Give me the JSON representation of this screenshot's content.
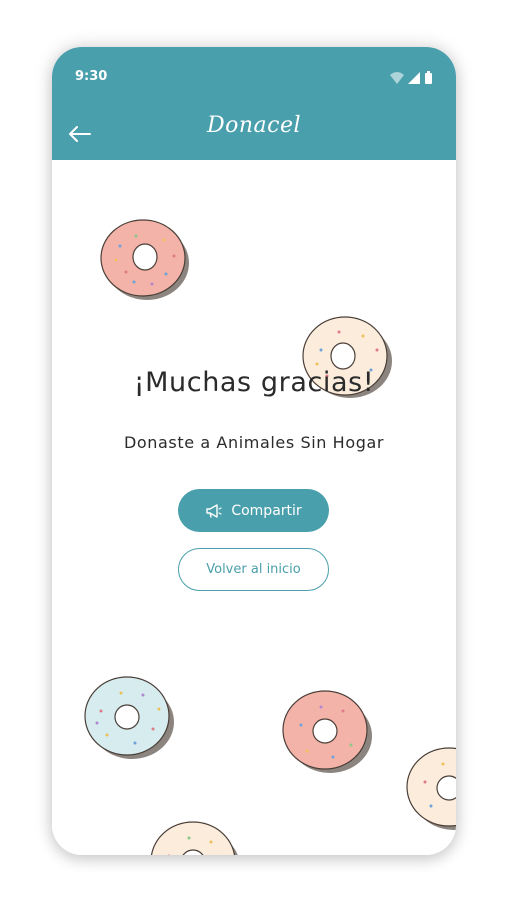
{
  "status_bar": {
    "time": "9:30",
    "icons": [
      "wifi-icon",
      "signal-icon",
      "battery-icon"
    ]
  },
  "app_bar": {
    "title": "Donacel",
    "back_icon": "arrow-left-icon"
  },
  "main": {
    "heading": "¡Muchas gracias!",
    "subtitle": "Donaste a Animales Sin Hogar",
    "share_button": {
      "label": "Compartir",
      "icon": "megaphone-icon"
    },
    "home_button": {
      "label": "Volver al inicio"
    }
  },
  "colors": {
    "primary": "#4a9fac",
    "text": "#2b2b2b",
    "donut_pink": "#f4b3a8",
    "donut_cream": "#fbecdc",
    "donut_blue": "#d6ecee"
  }
}
